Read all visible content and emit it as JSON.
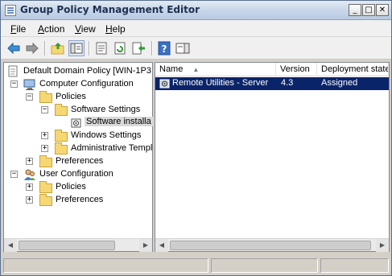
{
  "window": {
    "title": "Group Policy Management Editor",
    "minimize_glyph": "_",
    "maximize_glyph": "□",
    "close_glyph": "✕"
  },
  "menu": {
    "file": {
      "accel": "F",
      "rest": "ile"
    },
    "action": {
      "accel": "A",
      "rest": "ction"
    },
    "view": {
      "accel": "V",
      "rest": "iew"
    },
    "help": {
      "accel": "H",
      "rest": "elp"
    }
  },
  "toolbar": {
    "icons": [
      "back-arrow-icon",
      "forward-arrow-icon",
      "up-folder-icon",
      "show-hide-tree-icon",
      "properties-icon",
      "refresh-icon",
      "export-list-icon",
      "help-icon",
      "show-hide-action-pane-icon"
    ]
  },
  "tree": {
    "root": "Default Domain Policy [WIN-1P3",
    "computer_config": "Computer Configuration",
    "policies": "Policies",
    "software_settings": "Software Settings",
    "software_installation": "Software installa",
    "windows_settings": "Windows Settings",
    "admin_templates": "Administrative Templ",
    "preferences": "Preferences",
    "user_config": "User Configuration",
    "user_policies": "Policies",
    "user_preferences": "Preferences",
    "expand_glyph": "+",
    "collapse_glyph": "−"
  },
  "list": {
    "columns": [
      "Name",
      "Version",
      "Deployment state"
    ],
    "sort_glyph": "▲",
    "rows": [
      {
        "name": "Remote Utilities - Server",
        "version": "4.3",
        "state": "Assigned"
      }
    ]
  },
  "scrollbar": {
    "left_glyph": "◀",
    "right_glyph": "▶"
  },
  "colors": {
    "selection": "#0a246a",
    "folder": "#f6d873"
  }
}
